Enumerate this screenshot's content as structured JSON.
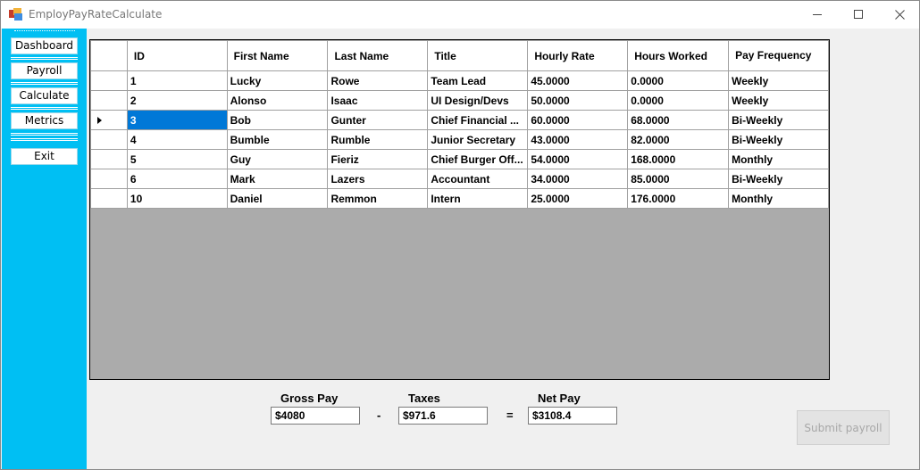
{
  "window": {
    "title": "EmployPayRateCalculate"
  },
  "sidebar": {
    "items": [
      {
        "label": "Dashboard"
      },
      {
        "label": "Payroll"
      },
      {
        "label": "Calculate"
      },
      {
        "label": "Metrics"
      },
      {
        "label": "Exit"
      }
    ]
  },
  "grid": {
    "columns": [
      "ID",
      "First Name",
      "Last Name",
      "Title",
      "Hourly Rate",
      "Hours Worked",
      "Pay Frequency"
    ],
    "selected_row_index": 2,
    "rows": [
      [
        "1",
        "Lucky",
        "Rowe",
        "Team Lead",
        "45.0000",
        "0.0000",
        "Weekly"
      ],
      [
        "2",
        "Alonso",
        "Isaac",
        "UI Design/Devs",
        "50.0000",
        "0.0000",
        "Weekly"
      ],
      [
        "3",
        "Bob",
        "Gunter",
        "Chief Financial ...",
        "60.0000",
        "68.0000",
        "Bi-Weekly"
      ],
      [
        "4",
        "Bumble",
        "Rumble",
        "Junior Secretary",
        "43.0000",
        "82.0000",
        "Bi-Weekly"
      ],
      [
        "5",
        "Guy",
        "Fieriz",
        "Chief Burger Off...",
        "54.0000",
        "168.0000",
        "Monthly"
      ],
      [
        "6",
        "Mark",
        "Lazers",
        "Accountant",
        "34.0000",
        "85.0000",
        "Bi-Weekly"
      ],
      [
        "10",
        "Daniel",
        "Remmon",
        "Intern",
        "25.0000",
        "176.0000",
        "Monthly"
      ]
    ]
  },
  "totals": {
    "gross_label": "Gross Pay",
    "gross_value": "$4080",
    "minus": "-",
    "taxes_label": "Taxes",
    "taxes_value": "$971.6",
    "equals": "=",
    "net_label": "Net Pay",
    "net_value": "$3108.4"
  },
  "actions": {
    "submit_label": "Submit payroll"
  },
  "colors": {
    "sidebar": "#00bff3",
    "selection": "#0078d7",
    "grid_background": "#ababab"
  }
}
